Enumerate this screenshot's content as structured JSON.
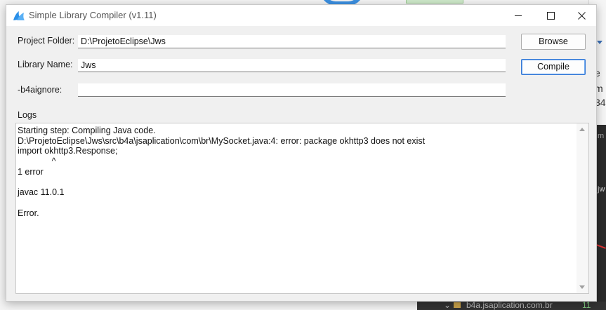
{
  "window": {
    "title": "Simple Library Compiler (v1.11)"
  },
  "form": {
    "project_folder_label": "Project Folder:",
    "project_folder_value": "D:\\ProjetoEclipse\\Jws",
    "library_name_label": "Library Name:",
    "library_name_value": "Jws",
    "b4aignore_label": "-b4aignore:",
    "b4aignore_value": ""
  },
  "buttons": {
    "browse_label": "Browse",
    "compile_label": "Compile"
  },
  "logs": {
    "label": "Logs",
    "content": "Starting step: Compiling Java code.\nD:\\ProjetoEclipse\\Jws\\src\\b4a\\jsaplication\\com\\br\\MySocket.java:4: error: package okhttp3 does not exist\nimport okhttp3.Response;\n              ^\n1 error\n\njavac 11.0.1\n\nError."
  },
  "background": {
    "side_letters": [
      "e",
      "m",
      "34"
    ],
    "side_letters_lower": [
      "m",
      "jw"
    ],
    "bottom_bar_text": "b4a.jsaplication.com.br",
    "bottom_bar_badge": "11"
  },
  "colors": {
    "accent": "#3a7bd5",
    "icon_blue": "#2a8fe8"
  }
}
